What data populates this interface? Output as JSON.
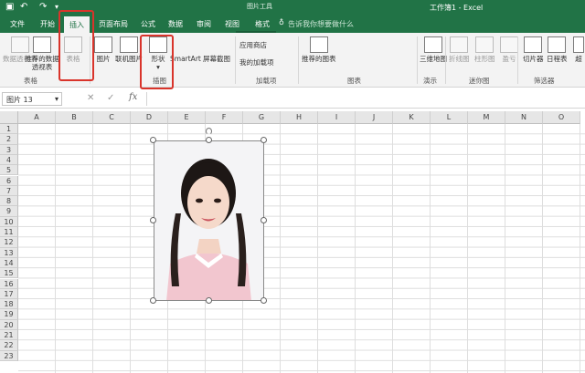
{
  "titlebar": {
    "undo_icon": "undo-icon",
    "redo_icon": "redo-icon",
    "context_tools": "图片工具",
    "doc_title": "工作簿1 - Excel"
  },
  "tabs": [
    "文件",
    "开始",
    "插入",
    "页面布局",
    "公式",
    "数据",
    "审阅",
    "视图",
    "格式"
  ],
  "tell_me": "告诉我你想要做什么",
  "ribbon": {
    "buttons": [
      "数据透视表",
      "推荐的数据透视表",
      "表格",
      "图片",
      "联机图片",
      "形状",
      "SmartArt",
      "屏幕截图",
      "应用商店",
      "我的加载项",
      "推荐的图表",
      "三维地图",
      "折线图",
      "柱形图",
      "盈亏",
      "切片器",
      "日程表",
      "超"
    ],
    "groups": [
      "表格",
      "插图",
      "加载项",
      "图表",
      "演示",
      "迷你图",
      "筛选器"
    ]
  },
  "formula_bar": {
    "name_box": "图片 13",
    "cancel": "✕",
    "enter": "✓",
    "fx": "fx",
    "content": ""
  },
  "sheet": {
    "columns": [
      "A",
      "B",
      "C",
      "D",
      "E",
      "F",
      "G",
      "H",
      "I",
      "J",
      "K",
      "L",
      "M",
      "N",
      "O"
    ],
    "rows": [
      "1",
      "2",
      "3",
      "4",
      "5",
      "6",
      "7",
      "8",
      "9",
      "10",
      "11",
      "12",
      "13",
      "14",
      "15",
      "16",
      "17",
      "18",
      "19",
      "20",
      "21",
      "22",
      "23"
    ]
  },
  "colors": {
    "excel_green": "#217346",
    "highlight_red": "#d9342b",
    "photo_bg": "#f4f4f6"
  }
}
